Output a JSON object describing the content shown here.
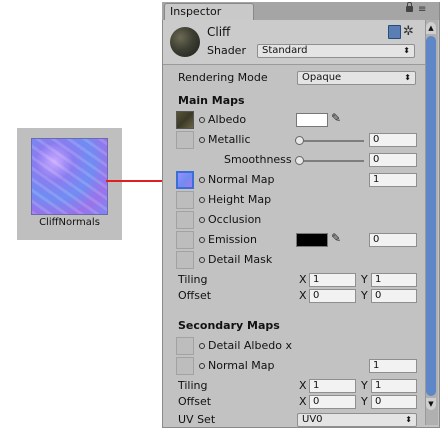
{
  "asset": {
    "label": "CliffNormals"
  },
  "inspector": {
    "tab_label": "Inspector",
    "menu_glyph": "≡",
    "material_name": "Cliff",
    "shader_label": "Shader",
    "shader_value": "Standard",
    "rendering_mode_label": "Rendering Mode",
    "rendering_mode_value": "Opaque",
    "main_maps_title": "Main Maps",
    "albedo_label": "Albedo",
    "metallic_label": "Metallic",
    "metallic_value": "0",
    "smoothness_label": "Smoothness",
    "smoothness_value": "0",
    "normal_map_label": "Normal Map",
    "normal_map_value": "1",
    "height_map_label": "Height Map",
    "occlusion_label": "Occlusion",
    "emission_label": "Emission",
    "emission_value": "0",
    "detail_mask_label": "Detail Mask",
    "tiling_label": "Tiling",
    "tiling_x_label": "X",
    "tiling_x_value": "1",
    "tiling_y_label": "Y",
    "tiling_y_value": "1",
    "offset_label": "Offset",
    "offset_x_label": "X",
    "offset_x_value": "0",
    "offset_y_label": "Y",
    "offset_y_value": "0",
    "secondary_maps_title": "Secondary Maps",
    "detail_albedo_label": "Detail Albedo x",
    "sec_normal_map_label": "Normal Map",
    "sec_normal_map_value": "1",
    "sec_tiling_label": "Tiling",
    "sec_tiling_x_label": "X",
    "sec_tiling_x_value": "1",
    "sec_tiling_y_label": "Y",
    "sec_tiling_y_value": "1",
    "sec_offset_label": "Offset",
    "sec_offset_x_label": "X",
    "sec_offset_x_value": "0",
    "sec_offset_y_label": "Y",
    "sec_offset_y_value": "0",
    "uv_set_label": "UV Set",
    "uv_set_value": "UV0",
    "dropdown_arrow": "⬍",
    "gear_glyph": "✲",
    "picker_glyph": "✎"
  },
  "colors": {
    "arrow": "#e02020",
    "albedo_swatch": "#ffffff",
    "emission_swatch": "#000000",
    "scroll_thumb": "#5f86c7"
  }
}
